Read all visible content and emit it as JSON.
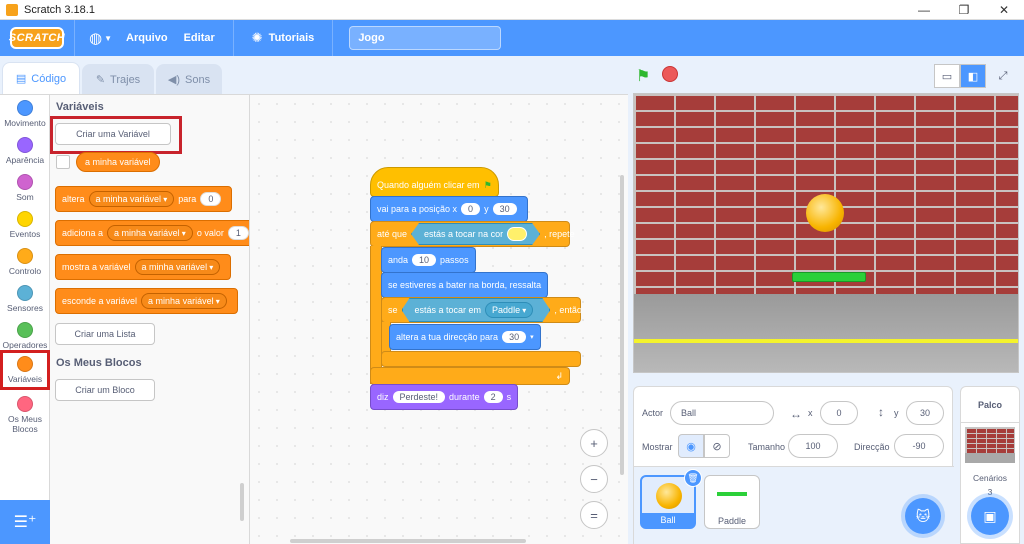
{
  "window": {
    "title": "Scratch 3.18.1",
    "minimize": "—",
    "restore": "❐",
    "close": "✕"
  },
  "menubar": {
    "logo": "SCRATCH",
    "file": "Arquivo",
    "edit": "Editar",
    "tutorials": "Tutoriais",
    "project_name": "Jogo"
  },
  "tabs": {
    "code": "Código",
    "costumes": "Trajes",
    "sounds": "Sons"
  },
  "categories": [
    {
      "label": "Movimento",
      "color": "#4c97ff"
    },
    {
      "label": "Aparência",
      "color": "#9966ff"
    },
    {
      "label": "Som",
      "color": "#cf63cf"
    },
    {
      "label": "Eventos",
      "color": "#ffd500"
    },
    {
      "label": "Controlo",
      "color": "#ffab19"
    },
    {
      "label": "Sensores",
      "color": "#5cb1d6"
    },
    {
      "label": "Operadores",
      "color": "#59c059"
    },
    {
      "label": "Variáveis",
      "color": "#ff8c1a"
    },
    {
      "label": "Os Meus Blocos",
      "color": "#ff6680"
    }
  ],
  "palette": {
    "variables_heading": "Variáveis",
    "make_variable": "Criar uma Variável",
    "my_variable": "a minha variável",
    "set_block": {
      "prefix": "altera",
      "var": "a minha variável",
      "mid": "para",
      "value": "0"
    },
    "change_block": {
      "prefix": "adiciona a",
      "var": "a minha variável",
      "mid": "o valor",
      "value": "1"
    },
    "show_block": {
      "prefix": "mostra a variável",
      "var": "a minha variável"
    },
    "hide_block": {
      "prefix": "esconde a variável",
      "var": "a minha variável"
    },
    "make_list": "Criar uma Lista",
    "myblocks_heading": "Os Meus Blocos",
    "make_block": "Criar um Bloco"
  },
  "script": {
    "hat": "Quando alguém clicar em",
    "goto": {
      "label": "vai para a posição x",
      "x": "0",
      "ylabel": "y",
      "y": "30"
    },
    "until": {
      "label": "até que",
      "sensing": "estás a tocar na cor",
      "suffix": ", repete"
    },
    "move": {
      "label": "anda",
      "steps": "10",
      "suffix": "passos"
    },
    "bounce": "se estiveres a bater na borda, ressalta",
    "if": {
      "label": "se",
      "sensing": "estás a tocar em",
      "target": "Paddle",
      "suffix": ", então"
    },
    "turn": {
      "label": "altera a tua direcção para",
      "value": "30"
    },
    "say": {
      "label": "diz",
      "message": "Perdeste!",
      "mid": "durante",
      "secs": "2",
      "suffix": "s"
    }
  },
  "zoom": {
    "in": "+",
    "out": "−",
    "reset": "="
  },
  "sprite_info": {
    "actor_label": "Actor",
    "actor_name": "Ball",
    "x_label": "x",
    "x": "0",
    "y_label": "y",
    "y": "30",
    "show_label": "Mostrar",
    "size_label": "Tamanho",
    "size": "100",
    "direction_label": "Direcção",
    "direction": "-90"
  },
  "sprites": [
    {
      "name": "Ball"
    },
    {
      "name": "Paddle"
    }
  ],
  "stage_pane": {
    "title": "Palco",
    "backdrops_label": "Cenários",
    "backdrops_count": "3"
  }
}
